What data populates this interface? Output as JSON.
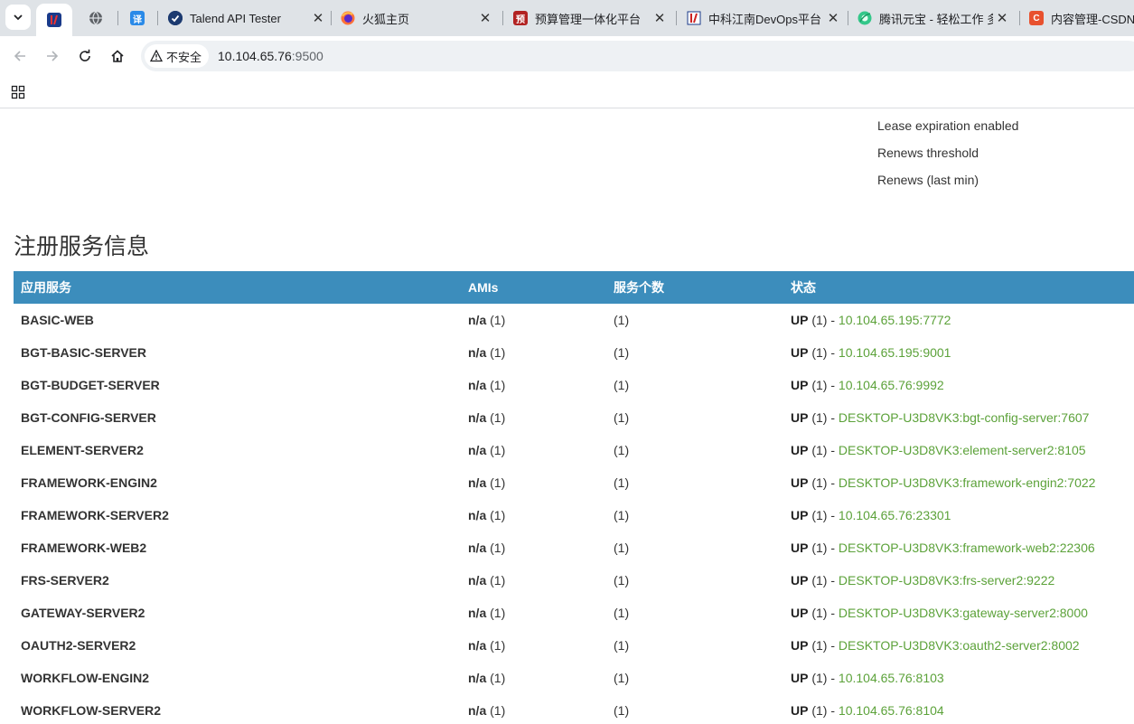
{
  "browser": {
    "tabs": [
      {
        "title": "",
        "favicon": "iv-logo-icon",
        "active": true
      },
      {
        "title": "",
        "favicon": "globe-icon",
        "active": false
      },
      {
        "title": "",
        "favicon": "translate-icon",
        "active": false
      },
      {
        "title": "Talend API Tester",
        "favicon": "talend-check-icon",
        "active": false
      },
      {
        "title": "火狐主页",
        "favicon": "firefox-icon",
        "active": false
      },
      {
        "title": "预算管理一体化平台",
        "favicon": "budget-seal-icon",
        "active": false
      },
      {
        "title": "中科江南DevOps平台",
        "favicon": "iv-logo-icon",
        "active": false
      },
      {
        "title": "腾讯元宝 - 轻松工作 多",
        "favicon": "yuanbao-icon",
        "active": false
      },
      {
        "title": "内容管理-CSDN创",
        "favicon": "csdn-icon",
        "active": false
      }
    ],
    "security_label": "不安全",
    "url_host": "10.104.65.76",
    "url_port": ":9500"
  },
  "lease_info": {
    "items": [
      "Lease expiration enabled",
      "Renews threshold",
      "Renews (last min)"
    ]
  },
  "registry": {
    "title": "注册服务信息",
    "columns": [
      "应用服务",
      "AMIs",
      "服务个数",
      "状态"
    ],
    "rows": [
      {
        "app": "BASIC-WEB",
        "ami": "n/a",
        "ami_count": "(1)",
        "count": "(1)",
        "status": "UP",
        "status_count": "(1) -",
        "instance": "10.104.65.195:7772"
      },
      {
        "app": "BGT-BASIC-SERVER",
        "ami": "n/a",
        "ami_count": "(1)",
        "count": "(1)",
        "status": "UP",
        "status_count": "(1) -",
        "instance": "10.104.65.195:9001"
      },
      {
        "app": "BGT-BUDGET-SERVER",
        "ami": "n/a",
        "ami_count": "(1)",
        "count": "(1)",
        "status": "UP",
        "status_count": "(1) -",
        "instance": "10.104.65.76:9992"
      },
      {
        "app": "BGT-CONFIG-SERVER",
        "ami": "n/a",
        "ami_count": "(1)",
        "count": "(1)",
        "status": "UP",
        "status_count": "(1) -",
        "instance": "DESKTOP-U3D8VK3:bgt-config-server:7607"
      },
      {
        "app": "ELEMENT-SERVER2",
        "ami": "n/a",
        "ami_count": "(1)",
        "count": "(1)",
        "status": "UP",
        "status_count": "(1) -",
        "instance": "DESKTOP-U3D8VK3:element-server2:8105"
      },
      {
        "app": "FRAMEWORK-ENGIN2",
        "ami": "n/a",
        "ami_count": "(1)",
        "count": "(1)",
        "status": "UP",
        "status_count": "(1) -",
        "instance": "DESKTOP-U3D8VK3:framework-engin2:7022"
      },
      {
        "app": "FRAMEWORK-SERVER2",
        "ami": "n/a",
        "ami_count": "(1)",
        "count": "(1)",
        "status": "UP",
        "status_count": "(1) -",
        "instance": "10.104.65.76:23301"
      },
      {
        "app": "FRAMEWORK-WEB2",
        "ami": "n/a",
        "ami_count": "(1)",
        "count": "(1)",
        "status": "UP",
        "status_count": "(1) -",
        "instance": "DESKTOP-U3D8VK3:framework-web2:22306"
      },
      {
        "app": "FRS-SERVER2",
        "ami": "n/a",
        "ami_count": "(1)",
        "count": "(1)",
        "status": "UP",
        "status_count": "(1) -",
        "instance": "DESKTOP-U3D8VK3:frs-server2:9222"
      },
      {
        "app": "GATEWAY-SERVER2",
        "ami": "n/a",
        "ami_count": "(1)",
        "count": "(1)",
        "status": "UP",
        "status_count": "(1) -",
        "instance": "DESKTOP-U3D8VK3:gateway-server2:8000"
      },
      {
        "app": "OAUTH2-SERVER2",
        "ami": "n/a",
        "ami_count": "(1)",
        "count": "(1)",
        "status": "UP",
        "status_count": "(1) -",
        "instance": "DESKTOP-U3D8VK3:oauth2-server2:8002"
      },
      {
        "app": "WORKFLOW-ENGIN2",
        "ami": "n/a",
        "ami_count": "(1)",
        "count": "(1)",
        "status": "UP",
        "status_count": "(1) -",
        "instance": "10.104.65.76:8103"
      },
      {
        "app": "WORKFLOW-SERVER2",
        "ami": "n/a",
        "ami_count": "(1)",
        "count": "(1)",
        "status": "UP",
        "status_count": "(1) -",
        "instance": "10.104.65.76:8104"
      }
    ]
  },
  "colors": {
    "header_bg": "#3c8dbc",
    "link": "#5ca23a",
    "tabstrip_bg": "#dfe3e7"
  }
}
